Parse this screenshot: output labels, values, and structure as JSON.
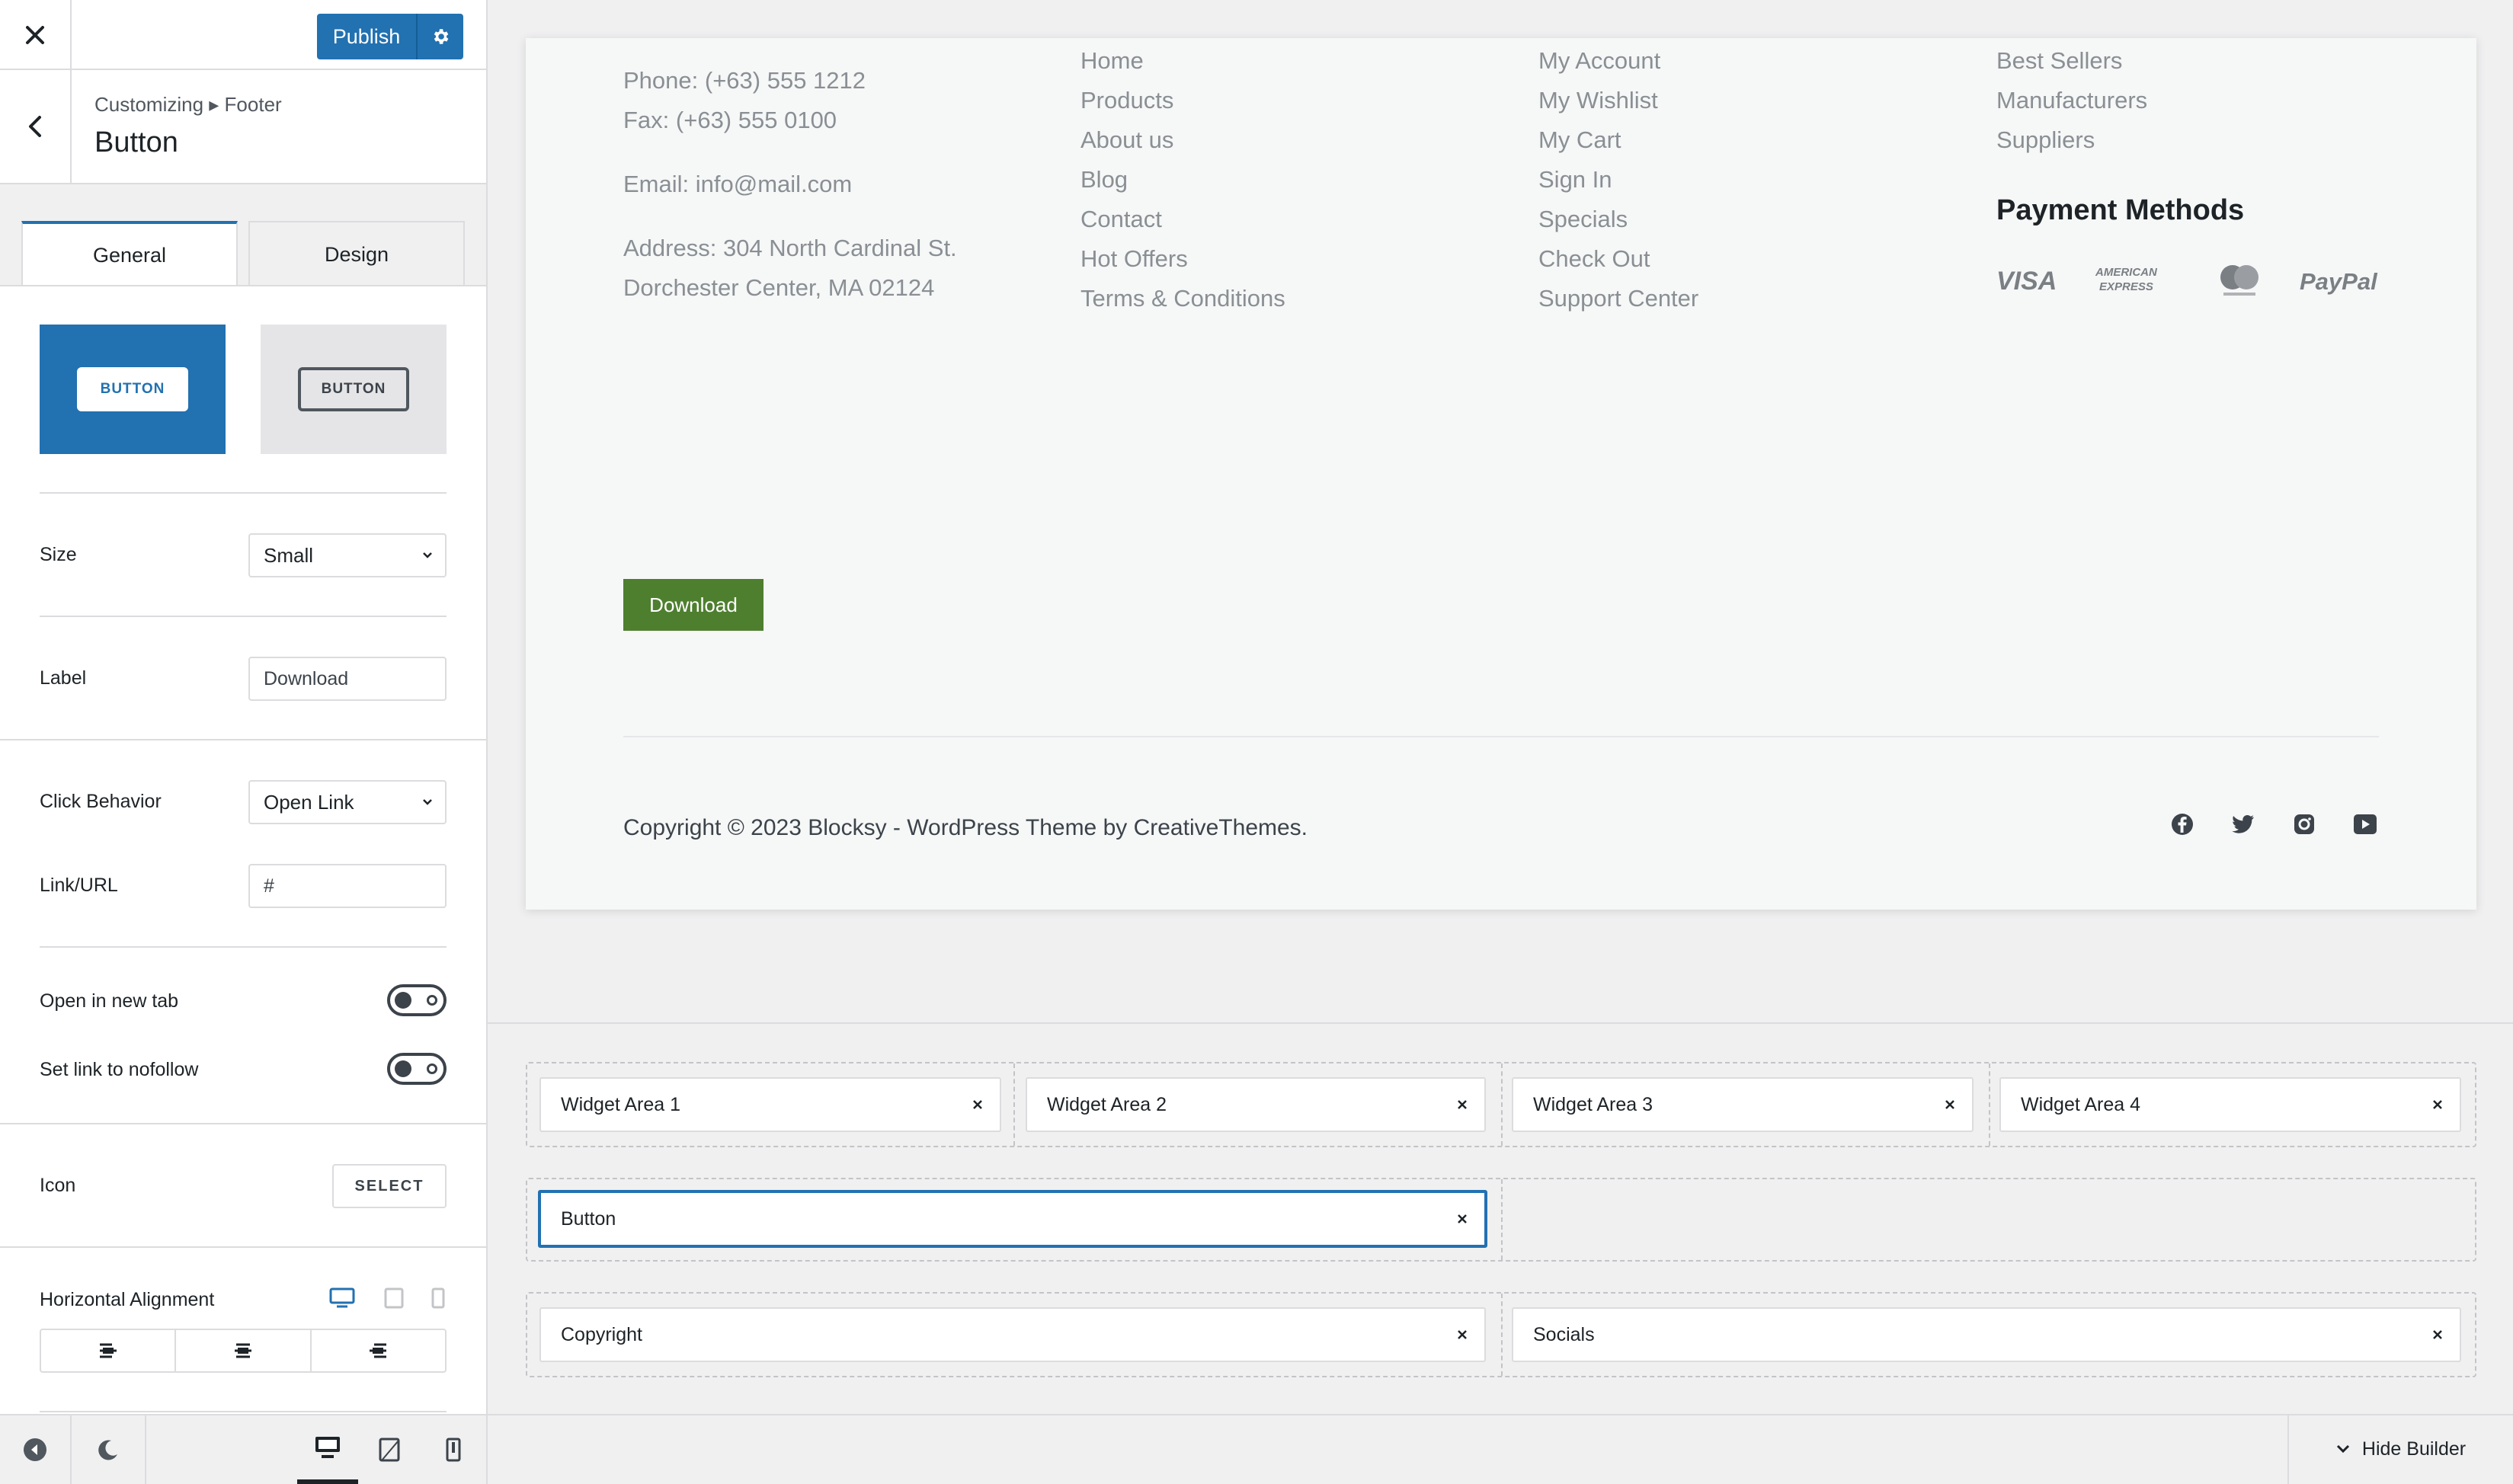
{
  "sidebar": {
    "publish_label": "Publish",
    "breadcrumb": "Customizing ▸ Footer",
    "section_title": "Button",
    "tabs": [
      {
        "label": "General"
      },
      {
        "label": "Design"
      }
    ],
    "style_cards": [
      {
        "label": "BUTTON"
      },
      {
        "label": "BUTTON"
      }
    ],
    "size": {
      "label": "Size",
      "value": "Small"
    },
    "label_field": {
      "label": "Label",
      "value": "Download"
    },
    "click_behavior": {
      "label": "Click Behavior",
      "value": "Open Link"
    },
    "link": {
      "label": "Link/URL",
      "value": "#"
    },
    "open_new_tab": {
      "label": "Open in new tab",
      "on": false
    },
    "nofollow": {
      "label": "Set link to nofollow",
      "on": false
    },
    "icon": {
      "label": "Icon",
      "button": "SELECT"
    },
    "alignment": {
      "label": "Horizontal Alignment"
    }
  },
  "preview": {
    "contact": {
      "phone": "Phone: (+63) 555 1212",
      "fax": "Fax: (+63) 555 0100",
      "email": "Email: info@mail.com",
      "address1": "Address: 304 North Cardinal St.",
      "address2": "Dorchester Center, MA 02124"
    },
    "col2": [
      "Home",
      "Products",
      "About us",
      "Blog",
      "Contact",
      "Hot Offers",
      "Terms & Conditions"
    ],
    "col3": [
      "My Account",
      "My Wishlist",
      "My Cart",
      "Sign In",
      "Specials",
      "Check Out",
      "Support Center"
    ],
    "col4": [
      "Best Sellers",
      "Manufacturers",
      "Suppliers"
    ],
    "payment_title": "Payment Methods",
    "payment": {
      "visa": "VISA",
      "amex_1": "AMERICAN",
      "amex_2": "EXPRESS",
      "paypal": "PayPal"
    },
    "download_label": "Download",
    "copyright": "Copyright © 2023 Blocksy - WordPress Theme by CreativeThemes."
  },
  "builder": {
    "row1": [
      "Widget Area 1",
      "Widget Area 2",
      "Widget Area 3",
      "Widget Area 4"
    ],
    "row2": [
      "Button"
    ],
    "row3": [
      "Copyright",
      "Socials"
    ],
    "hide_label": "Hide Builder"
  },
  "colors": {
    "accent": "#2271b1",
    "download_button": "#4e7f2f"
  }
}
